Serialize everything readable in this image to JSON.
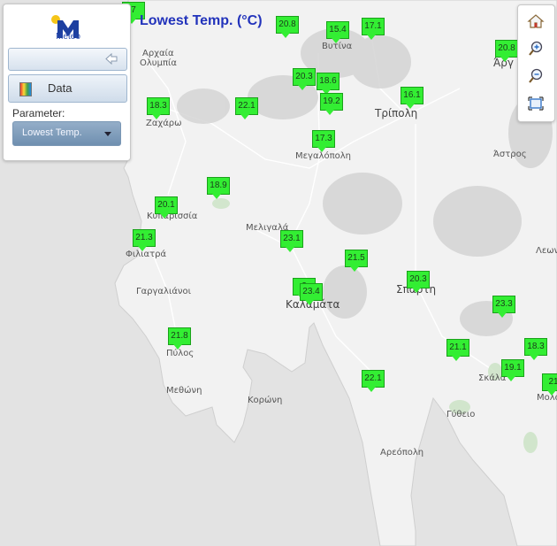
{
  "map": {
    "title": "Lowest Temp. (°C)",
    "places": [
      {
        "name": "Αρχαία",
        "big": false
      },
      {
        "name": "Ολυμπία",
        "big": false
      },
      {
        "name": "Ζαχάρω",
        "big": false
      },
      {
        "name": "Βυτίνα",
        "big": false
      },
      {
        "name": "Τρίπολη",
        "big": true
      },
      {
        "name": "Άργ",
        "big": true
      },
      {
        "name": "Μεγαλόπολη",
        "big": false
      },
      {
        "name": "Άστρος",
        "big": false
      },
      {
        "name": "Κυπαρισσία",
        "big": false
      },
      {
        "name": "Μελιγαλά",
        "big": false
      },
      {
        "name": "Φιλιατρά",
        "big": false
      },
      {
        "name": "Λεων",
        "big": false
      },
      {
        "name": "Γαργαλιάνοι",
        "big": false
      },
      {
        "name": "Καλαμάτα",
        "big": true
      },
      {
        "name": "Σπάρτη",
        "big": true
      },
      {
        "name": "Πύλος",
        "big": false
      },
      {
        "name": "Σκάλα",
        "big": false
      },
      {
        "name": "Μεθώνη",
        "big": false
      },
      {
        "name": "Κορώνη",
        "big": false
      },
      {
        "name": "Μολά",
        "big": false
      },
      {
        "name": "Γύθειο",
        "big": false
      },
      {
        "name": "Αρεόπολη",
        "big": false
      }
    ],
    "stations": [
      "7",
      "20.8",
      "15.4",
      "17.1",
      "20.8",
      "20.3",
      "18.6",
      "19.2",
      "16.1",
      "18.3",
      "22.1",
      "17.3",
      "18.9",
      "20.1",
      "21.3",
      "23.1",
      "21.5",
      "20.3",
      "2",
      "23.4",
      "23.3",
      "21.8",
      "21.1",
      "18.3",
      "19.1",
      "21",
      "22.1"
    ]
  },
  "panel": {
    "logo_text": "Meteo",
    "data_label": "Data",
    "parameter_label": "Parameter:",
    "parameter_value": "Lowest Temp."
  },
  "colors": {
    "marker_fill": "#33ee33",
    "marker_border": "#1aa21a",
    "title": "#2233bb",
    "land": "#f2f2f2",
    "sea": "#e3e3e3"
  },
  "icons": [
    "home-icon",
    "zoom-in-icon",
    "zoom-out-icon",
    "zoom-extent-icon",
    "collapse-arrow-icon",
    "palette-icon"
  ]
}
